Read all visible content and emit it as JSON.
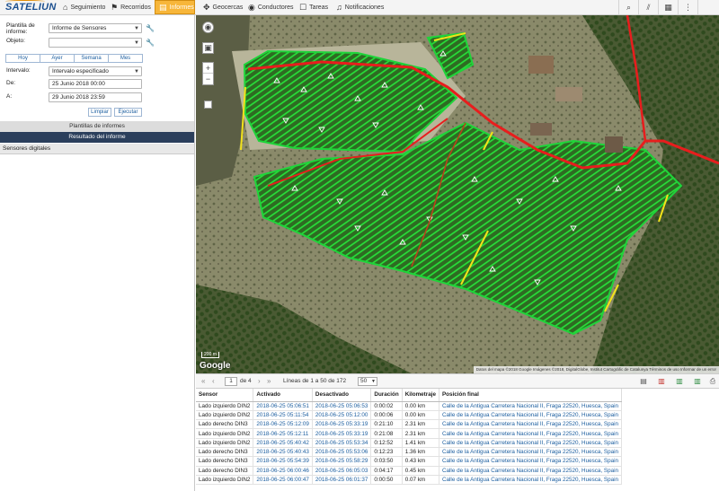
{
  "brand": {
    "logo": "SATELIUN"
  },
  "nav": {
    "tabs": [
      {
        "label": "Seguimiento",
        "icon": "home-icon"
      },
      {
        "label": "Recorridos",
        "icon": "flag-icon"
      },
      {
        "label": "Informes",
        "icon": "report-icon",
        "active": true
      },
      {
        "label": "Geocercas",
        "icon": "geofence-icon"
      },
      {
        "label": "Conductores",
        "icon": "driver-icon"
      },
      {
        "label": "Tareas",
        "icon": "tasks-icon"
      },
      {
        "label": "Notificaciones",
        "icon": "bell-icon"
      }
    ],
    "right_tools": [
      "search-icon",
      "chart-icon",
      "apps-grid-icon",
      "menu-icon"
    ]
  },
  "form": {
    "plantilla_label": "Plantilla de informe:",
    "plantilla_value": "Informe de Sensores",
    "objeto_label": "Objeto:",
    "objeto_value": "",
    "quick_buttons": [
      "Hoy",
      "Ayer",
      "Semana",
      "Mes"
    ],
    "intervalo_label": "Intervalo:",
    "intervalo_value": "Intervalo especificado",
    "de_label": "De:",
    "de_value": "25 Junio 2018 00:00",
    "a_label": "A:",
    "a_value": "29 Junio 2018 23:59",
    "limpiar": "Limpiar",
    "ejecutar": "Ejecutar"
  },
  "sections": {
    "plantillas": "Plantillas de informes",
    "resultado": "Resultado del informe",
    "sensores": "Sensores digitales"
  },
  "map": {
    "google": "Google",
    "scale": "200 m",
    "attribution": "Datos del mapa ©2018 Google Imágenes ©2018, DigitalGlobe, Institut Cartogràfic de Catalunya   Términos de uso   Informar de un error"
  },
  "pager": {
    "page": "1",
    "of_pages": "de 4",
    "lines": "Líneas de 1 a 50 de 172",
    "per_page": "50"
  },
  "table": {
    "headers": [
      "Sensor",
      "Activado",
      "Desactivado",
      "Duración",
      "Kilometraje",
      "Posición final"
    ],
    "rows": [
      [
        "Lado izquierdo DIN2",
        "2018-06-25 05:06:51",
        "2018-06-25 05:06:53",
        "0:00:02",
        "0.00 km",
        "Calle de la Antigua Carretera Nacional II, Fraga 22520, Huesca, Spain"
      ],
      [
        "Lado izquierdo DIN2",
        "2018-06-25 05:11:54",
        "2018-06-25 05:12:00",
        "0:00:06",
        "0.00 km",
        "Calle de la Antigua Carretera Nacional II, Fraga 22520, Huesca, Spain"
      ],
      [
        "Lado derecho DIN3",
        "2018-06-25 05:12:09",
        "2018-06-25 05:33:19",
        "0:21:10",
        "2.31 km",
        "Calle de la Antigua Carretera Nacional II, Fraga 22520, Huesca, Spain"
      ],
      [
        "Lado izquierdo DIN2",
        "2018-06-25 05:12:11",
        "2018-06-25 05:33:19",
        "0:21:08",
        "2.31 km",
        "Calle de la Antigua Carretera Nacional II, Fraga 22520, Huesca, Spain"
      ],
      [
        "Lado izquierdo DIN2",
        "2018-06-25 05:40:42",
        "2018-06-25 05:53:34",
        "0:12:52",
        "1.41 km",
        "Calle de la Antigua Carretera Nacional II, Fraga 22520, Huesca, Spain"
      ],
      [
        "Lado derecho DIN3",
        "2018-06-25 05:40:43",
        "2018-06-25 05:53:06",
        "0:12:23",
        "1.36 km",
        "Calle de la Antigua Carretera Nacional II, Fraga 22520, Huesca, Spain"
      ],
      [
        "Lado derecho DIN3",
        "2018-06-25 05:54:39",
        "2018-06-25 05:58:29",
        "0:03:50",
        "0.43 km",
        "Calle de la Antigua Carretera Nacional II, Fraga 22520, Huesca, Spain"
      ],
      [
        "Lado derecho DIN3",
        "2018-06-25 06:00:46",
        "2018-06-25 06:05:03",
        "0:04:17",
        "0.45 km",
        "Calle de la Antigua Carretera Nacional II, Fraga 22520, Huesca, Spain"
      ],
      [
        "Lado izquierdo DIN2",
        "2018-06-25 06:00:47",
        "2018-06-25 06:01:37",
        "0:00:50",
        "0.07 km",
        "Calle de la Antigua Carretera Nacional II, Fraga 22520, Huesca, Spain"
      ]
    ]
  },
  "export_icons": [
    "print-icon",
    "pdf-icon",
    "excel-icon",
    "xls-icon",
    "print-icon"
  ],
  "colors": {
    "active_tab": "#f7b63a",
    "header_dark": "#2b3f5c",
    "link": "#1d5fa0",
    "track_green": "#1fd43a",
    "road_red": "#e81d1d",
    "track_yellow": "#f2e21a"
  }
}
